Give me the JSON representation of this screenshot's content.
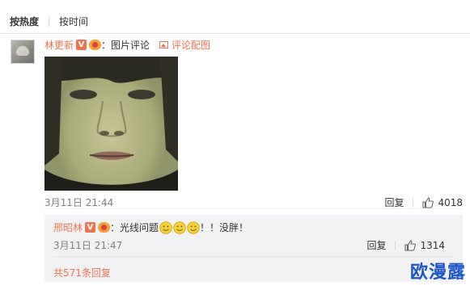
{
  "sort_bar": {
    "hot_label": "按热度",
    "time_label": "按时间"
  },
  "comment": {
    "username": "林更新",
    "v_badge": "V",
    "colon": "：",
    "content_label": "图片评论",
    "image_comment_link": "评论配图",
    "time": "3月11日 21:44",
    "reply_label": "回复",
    "like_count": "4018"
  },
  "reply": {
    "username": "邢昭林",
    "v_badge": "V",
    "colon": "：",
    "text_before": "光线问题",
    "emoji_count": 3,
    "text_after": "！！没胖！",
    "time": "3月11日 21:47",
    "reply_label": "回复",
    "like_count": "1314"
  },
  "more_replies": "共571条回复",
  "watermark": "欧漫露",
  "colors": {
    "accent": "#eb7350",
    "watermark": "#1e56c8",
    "sub_bg": "#f2f2f5"
  },
  "icons": [
    "image-icon",
    "thumb-up-icon",
    "smile-emoji-icon",
    "member-crown-icon",
    "v-verified-icon"
  ]
}
